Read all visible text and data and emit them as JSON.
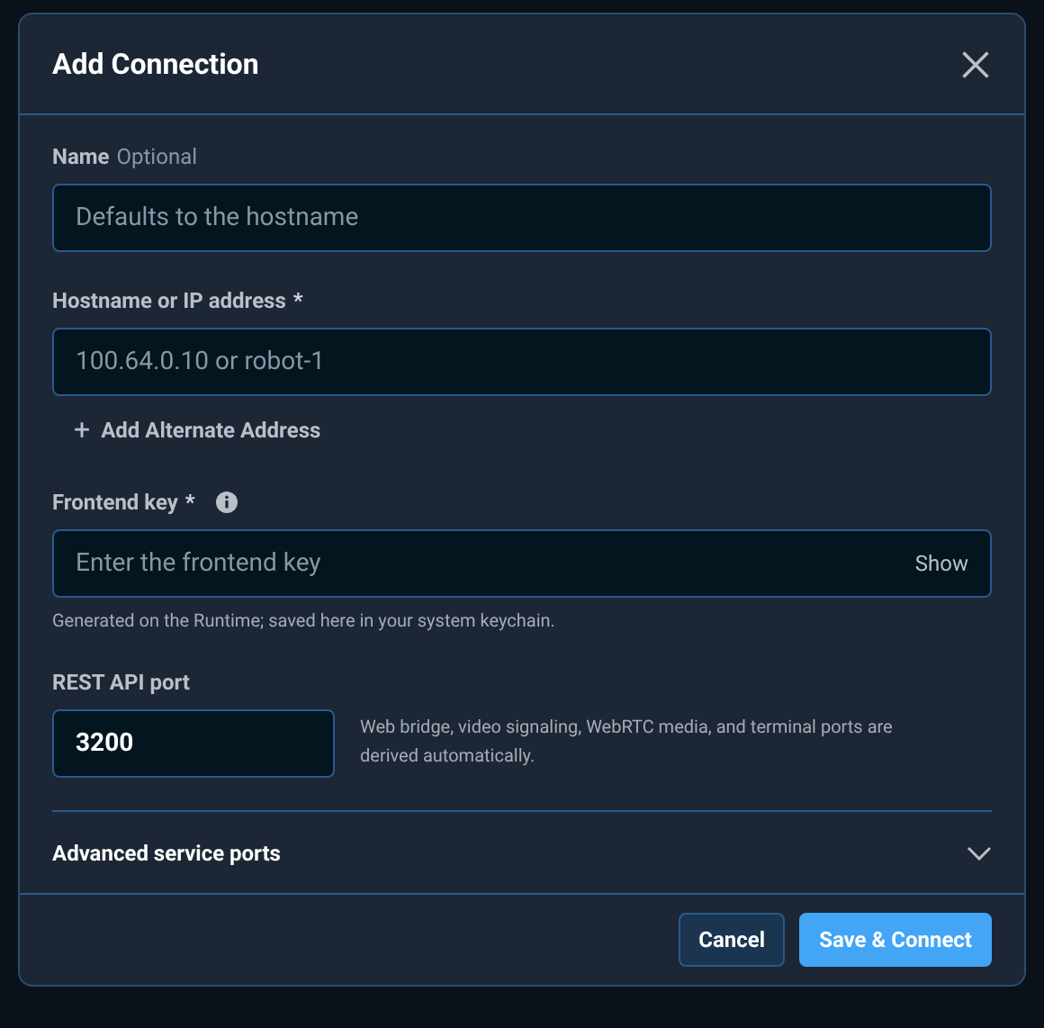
{
  "dialog": {
    "title": "Add Connection"
  },
  "name_field": {
    "label": "Name",
    "hint": "Optional",
    "placeholder": "Defaults to the hostname"
  },
  "host_field": {
    "label": "Hostname or IP address",
    "required_mark": "*",
    "placeholder": "100.64.0.10 or robot-1"
  },
  "add_alternate": {
    "icon": "+",
    "label": "Add Alternate Address"
  },
  "key_field": {
    "label": "Frontend key",
    "required_mark": "*",
    "placeholder": "Enter the frontend key",
    "toggle": "Show",
    "help": "Generated on the Runtime; saved here in your system keychain."
  },
  "port_field": {
    "label": "REST API port",
    "value": "3200",
    "note": "Web bridge, video signaling, WebRTC media, and terminal ports are derived automatically."
  },
  "advanced": {
    "label": "Advanced service ports",
    "expanded": false
  },
  "buttons": [
    {
      "label": "Cancel",
      "kind": "secondary"
    },
    {
      "label": "Save & Connect",
      "kind": "primary"
    }
  ]
}
